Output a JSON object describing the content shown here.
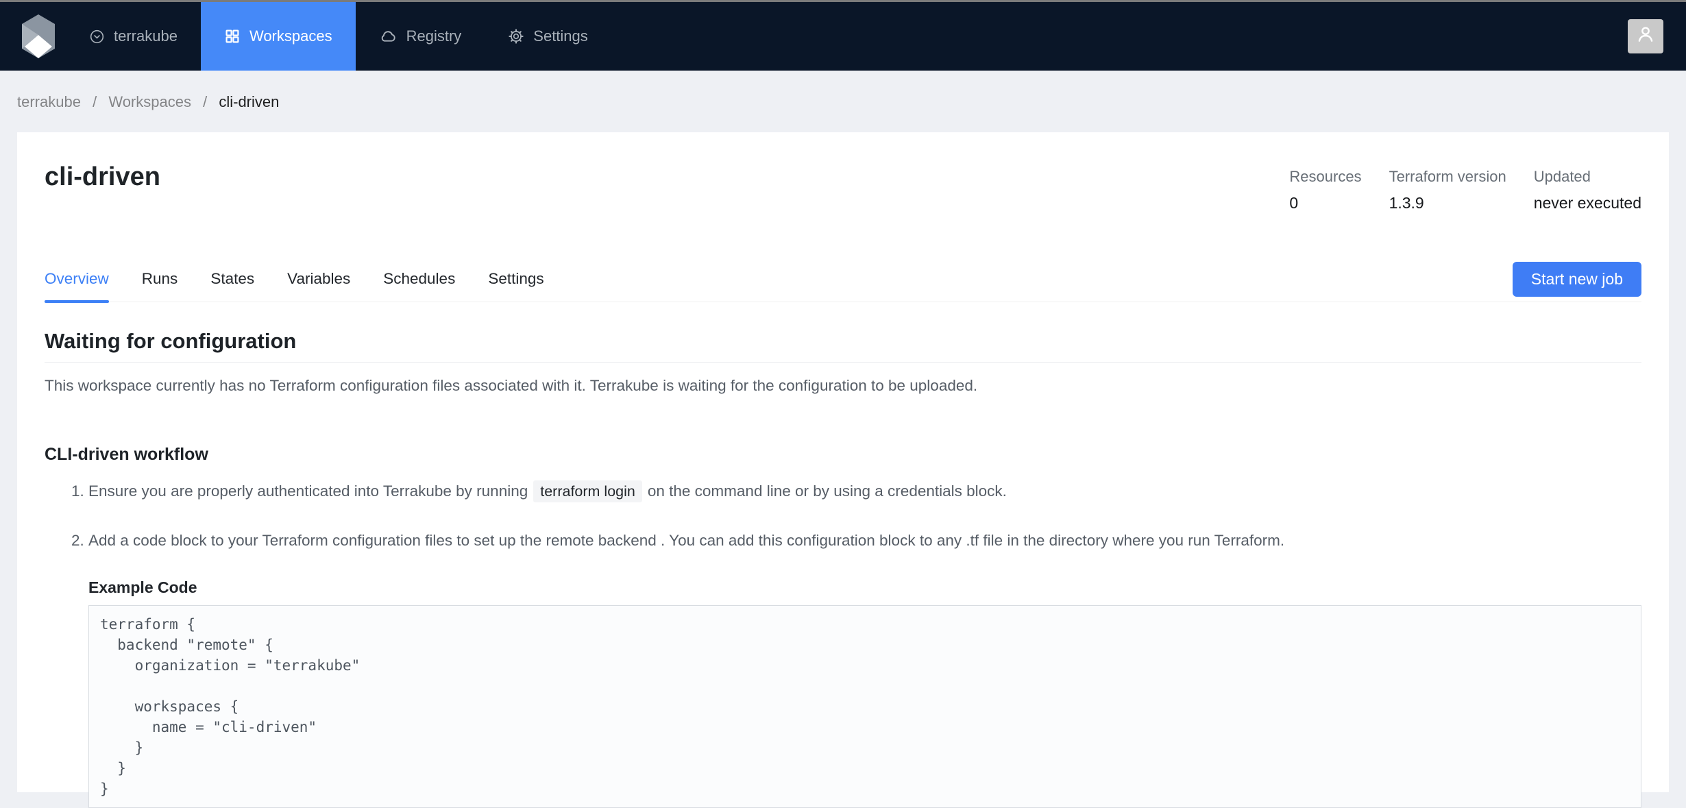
{
  "navbar": {
    "items": [
      {
        "label": "terrakube",
        "icon": "down-circle-icon"
      },
      {
        "label": "Workspaces",
        "icon": "grid-icon",
        "active": true
      },
      {
        "label": "Registry",
        "icon": "cloud-icon"
      },
      {
        "label": "Settings",
        "icon": "gear-icon"
      }
    ]
  },
  "breadcrumb": {
    "separator": "/",
    "items": [
      "terrakube",
      "Workspaces",
      "cli-driven"
    ]
  },
  "workspace": {
    "title": "cli-driven",
    "stats": [
      {
        "label": "Resources",
        "value": "0"
      },
      {
        "label": "Terraform version",
        "value": "1.3.9"
      },
      {
        "label": "Updated",
        "value": "never executed"
      }
    ]
  },
  "tabs": {
    "active": "Overview",
    "items": [
      "Overview",
      "Runs",
      "States",
      "Variables",
      "Schedules",
      "Settings"
    ]
  },
  "actions": {
    "start_new_job": "Start new job"
  },
  "content": {
    "heading": "Waiting for configuration",
    "description": "This workspace currently has no Terraform configuration files associated with it. Terrakube is waiting for the configuration to be uploaded.",
    "workflow_heading": "CLI-driven workflow",
    "steps": [
      {
        "prefix": "Ensure you are properly authenticated into Terrakube by running",
        "code": "terraform login",
        "suffix": "on the command line or by using a credentials block."
      },
      {
        "text": "Add a code block to your Terraform configuration files to set up the remote backend . You can add this configuration block to any .tf file in the directory where you run Terraform."
      }
    ],
    "example_code_label": "Example Code",
    "example_code": "terraform {\n  backend \"remote\" {\n    organization = \"terrakube\"\n\n    workspaces {\n      name = \"cli-driven\"\n    }\n  }\n}"
  },
  "colors": {
    "nav_background": "#0a1628",
    "nav_active_background": "#4589f8",
    "accent_blue": "#3d80f6",
    "button_blue": "#3f7df5",
    "page_background": "#eef0f4"
  }
}
